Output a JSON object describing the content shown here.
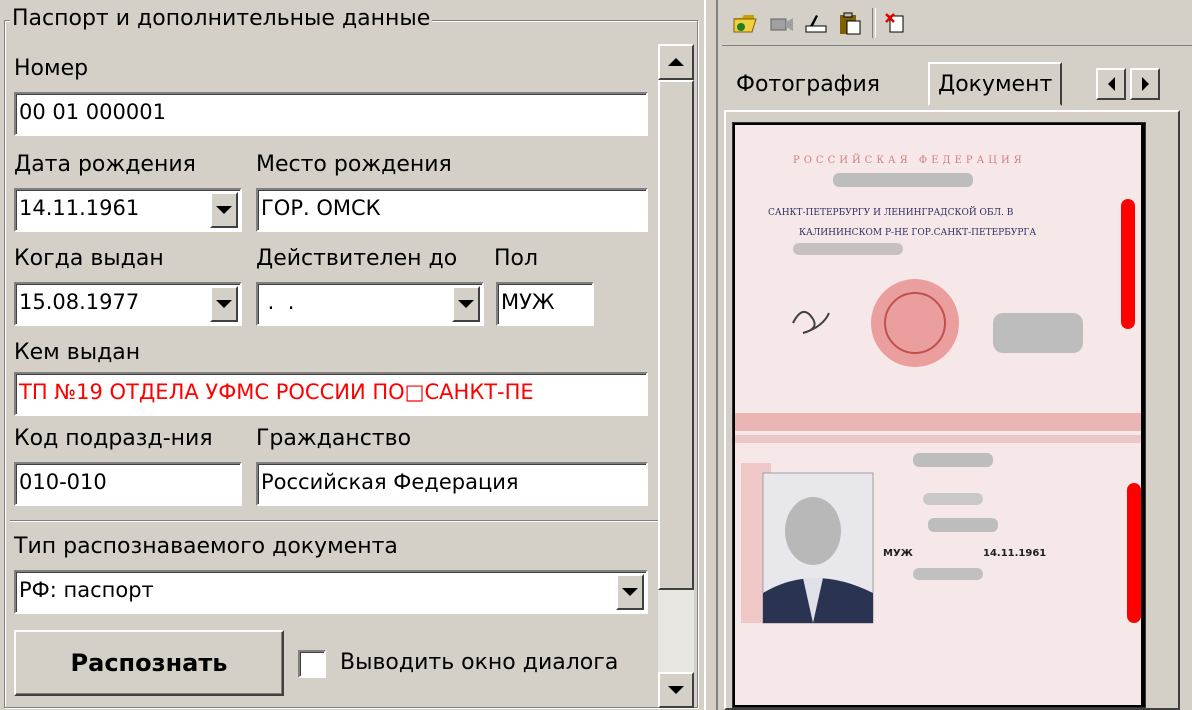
{
  "left_panel": {
    "group_title": "Паспорт и дополнительные данные",
    "number": {
      "label": "Номер",
      "value": "00 01 000001"
    },
    "birth_date": {
      "label": "Дата рождения",
      "value": "14.11.1961"
    },
    "birth_place": {
      "label": "Место рождения",
      "value": "ГОР. ОМСК"
    },
    "issued_date": {
      "label": "Когда выдан",
      "value": "15.08.1977"
    },
    "valid_until": {
      "label": "Действителен до",
      "value": " .  ."
    },
    "sex": {
      "label": "Пол",
      "value": "МУЖ"
    },
    "issued_by": {
      "label": "Кем выдан",
      "value": "ТП №19 ОТДЕЛА УФМС РОССИИ ПО□САНКТ-ПЕ"
    },
    "division_code": {
      "label": "Код подразд-ния",
      "value": "010-010"
    },
    "citizenship": {
      "label": "Гражданство",
      "value": "Российская Федерация"
    },
    "doc_type": {
      "label": "Тип распознаваемого документа",
      "value": "РФ: паспорт"
    },
    "recognize_button": "Распознать",
    "show_dialog": {
      "label": "Выводить окно диалога",
      "checked": false
    }
  },
  "right_panel": {
    "toolbar_icons": [
      "open-folder-icon",
      "camera-icon",
      "scanner-icon",
      "paste-icon",
      "delete-icon"
    ],
    "tabs": [
      "Фотография",
      "Документ"
    ],
    "active_tab": "Документ",
    "document": {
      "header": "РОССИЙСКАЯ ФЕДЕРАЦИЯ",
      "issued_line_1": "САНКТ-ПЕТЕРБУРГУ И ЛЕНИНГРАДСКОЙ ОБЛ. В",
      "issued_line_2": "КАЛИНИНСКОМ Р-НЕ ГОР.САНКТ-ПЕТЕРБУРГА",
      "sex_value": "МУЖ",
      "birth_date_value": "14.11.1961"
    }
  },
  "colors": {
    "window_bg": "#d4d0c8",
    "error_text": "#ff0000",
    "doc_page": "#f6e6e6"
  }
}
